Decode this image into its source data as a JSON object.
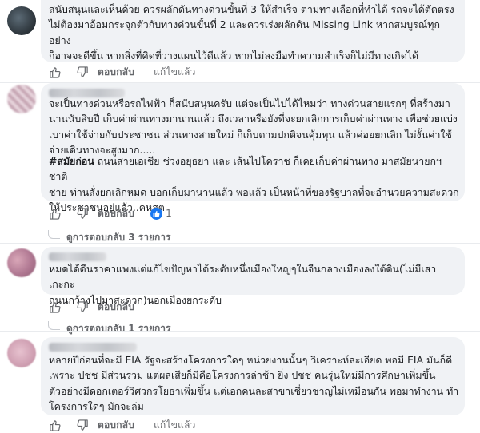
{
  "actions": {
    "reply_label": "ตอบกลับ",
    "edit_label": "แก้ไขแล้ว"
  },
  "comments": [
    {
      "lines": [
        "สนับสนุนและเห็นด้วย ควรผลักดันทางด่วนขั้นที่ 3 ให้สำเร็จ ตามทางเลือกที่ทำได้ รถจะได้ตัดตรง",
        "ไม่ต้องมาอ้อมกระจุกตัวกับทางด่วนขั้นที่ 2 และควรเร่งผลักดัน Missing Link หากสมบูรณ์ทุกอย่าง",
        "ก็อาจจะดีขึ้น หากสิ่งที่คิดที่วางแผนไว้ดีแล้ว หากไม่ลงมือทำความสำเร็จก็ไม่มีทางเกิดได้"
      ]
    },
    {
      "para1": [
        "จะเป็นทางด่วนหรือรถไฟฟ้า ก็สนับสนุนครับ แต่จะเป็นไปได้ไหมว่า ทางด่วนสายแรกๆ ที่สร้างมา",
        "นานนับสิบปี เก็บค่าผ่านทางมานานแล้ว ถึงเวลาหรือยังที่จะยกเลิกการเก็บค่าผ่านทาง เพื่อช่วยแบ่ง",
        "เบาค่าใช้จ่ายกับประชาชน ส่วนทางสายใหม่ ก็เก็บตามปกติจนคุ้มทุน แล้วค่อยยกเลิก ไม่งั้นค่าใช้",
        "จ่ายเดินทางจะสูงมาก....."
      ],
      "hashtag": "#สมัยก่อน",
      "para2_first_rest": " ถนนสายเอเชีย ช่วงอยุธยา และ เส้นไปโคราช ก็เคยเก็บค่าผ่านทาง มาสมัยนายกฯชาติ",
      "para2": [
        "ชาย ท่านสั่งยกเลิกหมด บอกเก็บมานานแล้ว พอแล้ว เป็นหน้าที่ของรัฐบาลที่จะอำนวยความสะดวก",
        "ให้ประชาชนอยู่แล้ว..คหสต"
      ],
      "reaction_count": "1",
      "replies_label": "ดูการตอบกลับ 3 รายการ"
    },
    {
      "lines": [
        "หมดได้ดีนราคาแพงแต่แก้ไขปัญหาได้ระดับหนึ่งเมืองใหญ่ๆในจีนกลางเมืองลงใต้ดิน(ไม่มีเสาเกะกะ",
        "ถนนกว้างไปมาสะดวก)นอกเมืองยกระดับ"
      ],
      "replies_label": "ดูการตอบกลับ 1 รายการ"
    },
    {
      "lines": [
        "หลายปีก่อนที่จะมี EIA รัฐจะสร้างโครงการใดๆ หน่วยงานนั้นๆ วิเคราะห์ละเอียด พอมี EIA มันก็ดี",
        "เพราะ ปชช มีส่วนร่วม แต่ผลเสียก็มีคือโครงการล่าช้า ยิ่ง ปชช คนรุ่นใหม่มีการศึกษาเพิ่มขึ้น",
        "ตัวอย่างมีดอกเตอร์วิศวกรโยธาเพิ่มขึ้น แต่เอกคนละสาขาเชี่ยวชาญไม่เหมือนกัน พอมาทำงาน ทำ",
        "โครงการใดๆ มักจะล่ม"
      ]
    }
  ],
  "colors": {
    "bubble": "#f0f2f5",
    "secondary_text": "#65676b",
    "like_blue": "#1877f2"
  }
}
